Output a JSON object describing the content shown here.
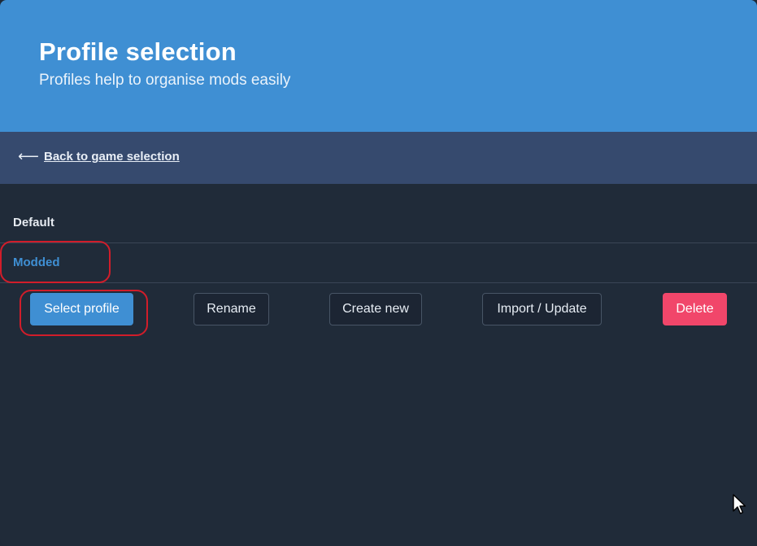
{
  "header": {
    "title": "Profile selection",
    "subtitle": "Profiles help to organise mods easily"
  },
  "nav": {
    "back_label": "Back to game selection",
    "back_icon": "arrow-left-icon"
  },
  "profiles": [
    {
      "name": "Default",
      "selected": false
    },
    {
      "name": "Modded",
      "selected": true
    }
  ],
  "actions": {
    "select_label": "Select profile",
    "rename_label": "Rename",
    "create_label": "Create new",
    "import_label": "Import / Update",
    "delete_label": "Delete"
  },
  "colors": {
    "primary": "#3f8fd3",
    "danger": "#f1466a",
    "nav_bar": "#364a6e",
    "background": "#202b39",
    "annotation": "#d11d2a"
  }
}
